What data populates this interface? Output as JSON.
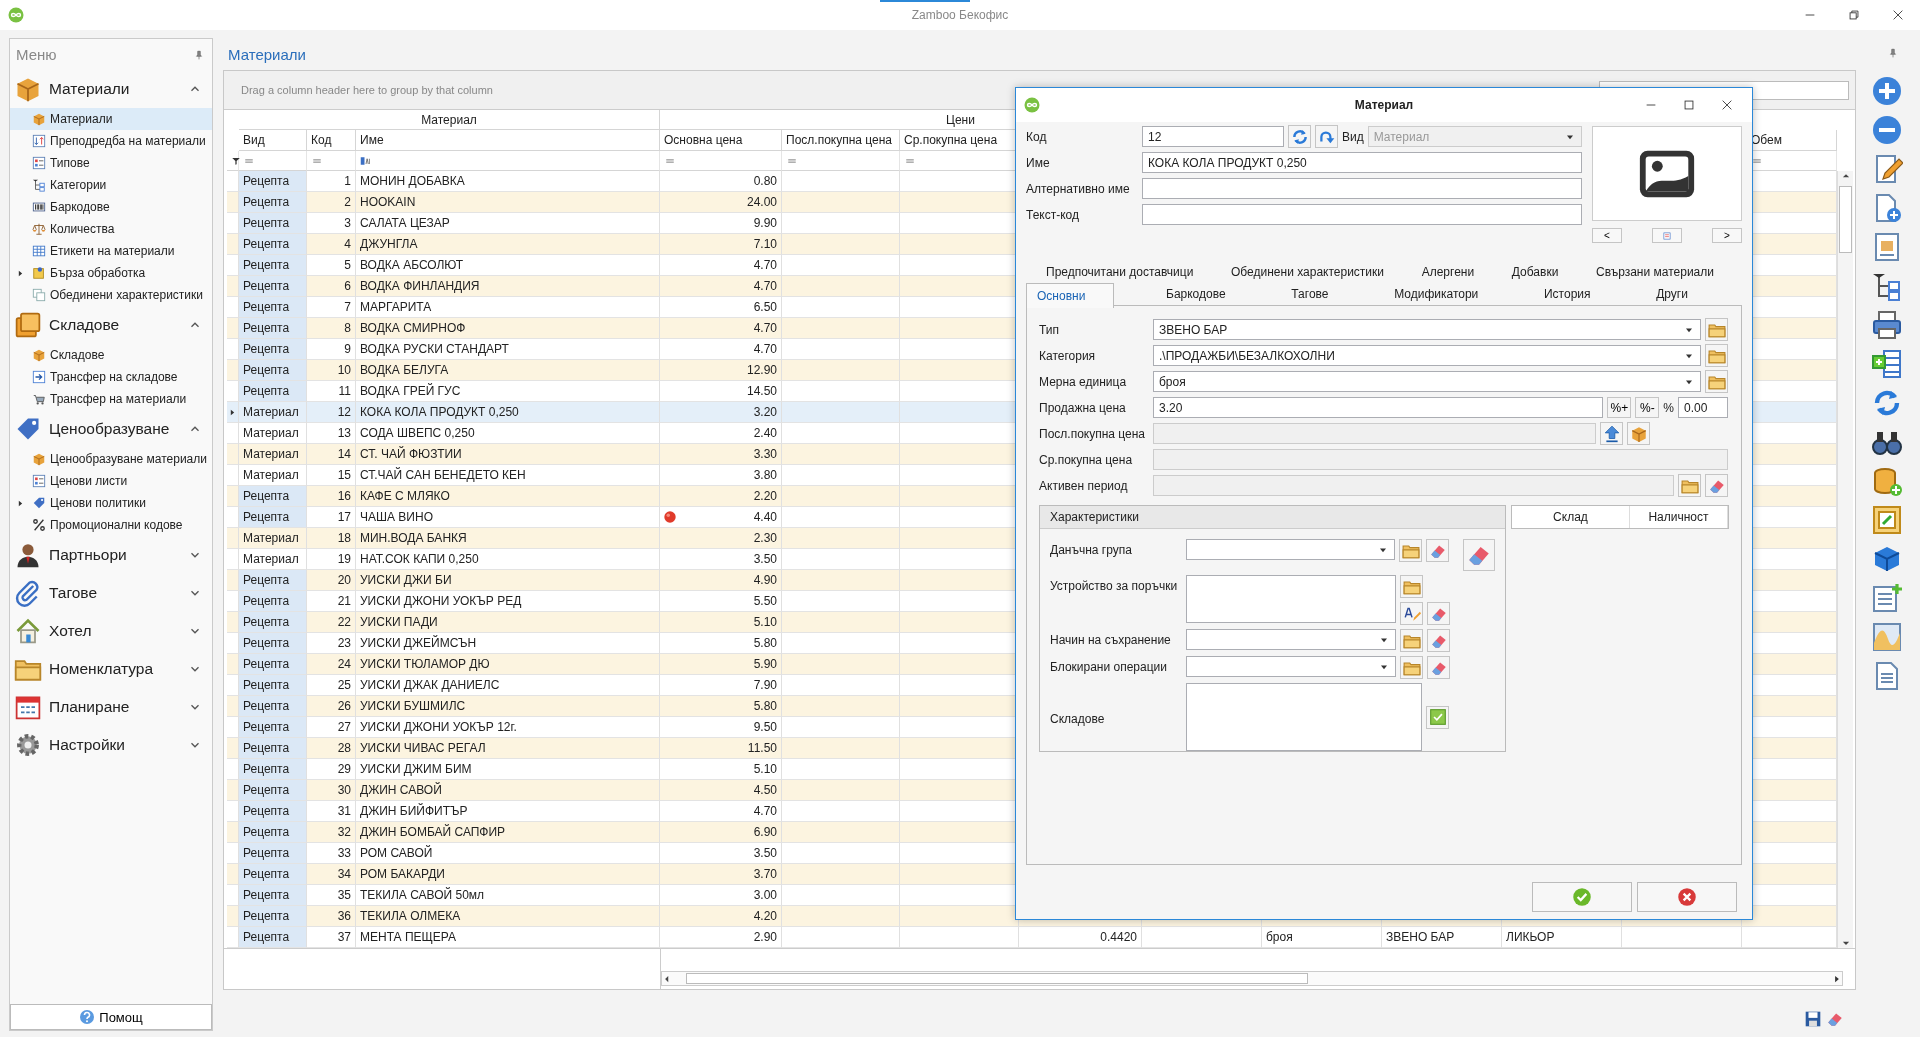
{
  "window": {
    "title": "Zamboo Бекофис"
  },
  "sidebar": {
    "title": "Меню",
    "help_button": "Помощ",
    "groups": [
      {
        "title": "Материали",
        "expanded": true,
        "items": [
          {
            "label": "Материали",
            "selected": true,
            "has_children": false
          },
          {
            "label": "Преподредба на материали",
            "selected": false,
            "has_children": false
          },
          {
            "label": "Типове",
            "selected": false,
            "has_children": false
          },
          {
            "label": "Категории",
            "selected": false,
            "has_children": false
          },
          {
            "label": "Баркодове",
            "selected": false,
            "has_children": false
          },
          {
            "label": "Количества",
            "selected": false,
            "has_children": false
          },
          {
            "label": "Етикети на материали",
            "selected": false,
            "has_children": false
          },
          {
            "label": "Бърза обработка",
            "selected": false,
            "has_children": true
          },
          {
            "label": "Обединени характеристики",
            "selected": false,
            "has_children": false
          }
        ]
      },
      {
        "title": "Складове",
        "expanded": true,
        "items": [
          {
            "label": "Складове",
            "selected": false,
            "has_children": false
          },
          {
            "label": "Трансфер на складове",
            "selected": false,
            "has_children": false
          },
          {
            "label": "Трансфер на материали",
            "selected": false,
            "has_children": false
          }
        ]
      },
      {
        "title": "Ценообразуване",
        "expanded": true,
        "items": [
          {
            "label": "Ценообразуване материали",
            "selected": false,
            "has_children": false
          },
          {
            "label": "Ценови листи",
            "selected": false,
            "has_children": false
          },
          {
            "label": "Ценови политики",
            "selected": false,
            "has_children": true
          },
          {
            "label": "Промоционални кодове",
            "selected": false,
            "has_children": false
          }
        ]
      },
      {
        "title": "Партньори",
        "expanded": false
      },
      {
        "title": "Тагове",
        "expanded": false
      },
      {
        "title": "Хотел",
        "expanded": false
      },
      {
        "title": "Номенклатура",
        "expanded": false
      },
      {
        "title": "Планиране",
        "expanded": false
      },
      {
        "title": "Настройки",
        "expanded": false
      }
    ]
  },
  "page": {
    "title": "Материали"
  },
  "grid": {
    "group_panel_hint": "Drag a column header here to group by that column",
    "bands": [
      {
        "label": "Материал"
      },
      {
        "label": "Цени"
      }
    ],
    "columns": [
      {
        "header": "Вид"
      },
      {
        "header": "Код"
      },
      {
        "header": "Име"
      },
      {
        "header": "Основна цена"
      },
      {
        "header": "Посл.покупна цена"
      },
      {
        "header": "Ср.покупна цена"
      },
      {
        "header": "Обем"
      }
    ],
    "rows": [
      {
        "kind": "recipe",
        "selected": false,
        "flagged": false,
        "type": "Рецепта",
        "code": "1",
        "name": "МОНИН ДОБАВКА",
        "base_price": "0.80"
      },
      {
        "kind": "recipe",
        "selected": false,
        "flagged": false,
        "type": "Рецепта",
        "code": "2",
        "name": "HOOKAIN",
        "base_price": "24.00"
      },
      {
        "kind": "recipe",
        "selected": false,
        "flagged": false,
        "type": "Рецепта",
        "code": "3",
        "name": "САЛАТА ЦЕЗАР",
        "base_price": "9.90"
      },
      {
        "kind": "recipe",
        "selected": false,
        "flagged": false,
        "type": "Рецепта",
        "code": "4",
        "name": "ДЖУНГЛА",
        "base_price": "7.10"
      },
      {
        "kind": "recipe",
        "selected": false,
        "flagged": false,
        "type": "Рецепта",
        "code": "5",
        "name": "ВОДКА АБСОЛЮТ",
        "base_price": "4.70"
      },
      {
        "kind": "recipe",
        "selected": false,
        "flagged": false,
        "type": "Рецепта",
        "code": "6",
        "name": "ВОДКА ФИНЛАНДИЯ",
        "base_price": "4.70"
      },
      {
        "kind": "recipe",
        "selected": false,
        "flagged": false,
        "type": "Рецепта",
        "code": "7",
        "name": "МАРГАРИТА",
        "base_price": "6.50"
      },
      {
        "kind": "recipe",
        "selected": false,
        "flagged": false,
        "type": "Рецепта",
        "code": "8",
        "name": "ВОДКА СМИРНОФ",
        "base_price": "4.70"
      },
      {
        "kind": "recipe",
        "selected": false,
        "flagged": false,
        "type": "Рецепта",
        "code": "9",
        "name": "ВОДКА РУСКИ СТАНДАРТ",
        "base_price": "4.70"
      },
      {
        "kind": "recipe",
        "selected": false,
        "flagged": false,
        "type": "Рецепта",
        "code": "10",
        "name": "ВОДКА БЕЛУГА",
        "base_price": "12.90"
      },
      {
        "kind": "recipe",
        "selected": false,
        "flagged": false,
        "type": "Рецепта",
        "code": "11",
        "name": "ВОДКА ГРЕЙ ГУС",
        "base_price": "14.50"
      },
      {
        "kind": "material",
        "selected": true,
        "flagged": false,
        "type": "Материал",
        "code": "12",
        "name": "КОКА КОЛА ПРОДУКТ 0,250",
        "base_price": "3.20"
      },
      {
        "kind": "material",
        "selected": false,
        "flagged": false,
        "type": "Материал",
        "code": "13",
        "name": "СОДА ШВЕПС 0,250",
        "base_price": "2.40"
      },
      {
        "kind": "material",
        "selected": false,
        "flagged": false,
        "type": "Материал",
        "code": "14",
        "name": "СТ. ЧАЙ ФЮЗТИИ",
        "base_price": "3.30"
      },
      {
        "kind": "material",
        "selected": false,
        "flagged": false,
        "type": "Материал",
        "code": "15",
        "name": "СТ.ЧАЙ САН БЕНЕДЕТО КЕН",
        "base_price": "3.80"
      },
      {
        "kind": "recipe",
        "selected": false,
        "flagged": false,
        "type": "Рецепта",
        "code": "16",
        "name": "КАФЕ С МЛЯКО",
        "base_price": "2.20"
      },
      {
        "kind": "recipe",
        "selected": false,
        "flagged": true,
        "type": "Рецепта",
        "code": "17",
        "name": "ЧАША ВИНО",
        "base_price": "4.40"
      },
      {
        "kind": "material",
        "selected": false,
        "flagged": false,
        "type": "Материал",
        "code": "18",
        "name": "МИН.ВОДА БАНКЯ",
        "base_price": "2.30"
      },
      {
        "kind": "material",
        "selected": false,
        "flagged": false,
        "type": "Материал",
        "code": "19",
        "name": "НАТ.СОК КАПИ 0,250",
        "base_price": "3.50"
      },
      {
        "kind": "recipe",
        "selected": false,
        "flagged": false,
        "type": "Рецепта",
        "code": "20",
        "name": "УИСКИ ДЖИ БИ",
        "base_price": "4.90"
      },
      {
        "kind": "recipe",
        "selected": false,
        "flagged": false,
        "type": "Рецепта",
        "code": "21",
        "name": "УИСКИ ДЖОНИ УОКЪР РЕД",
        "base_price": "5.50"
      },
      {
        "kind": "recipe",
        "selected": false,
        "flagged": false,
        "type": "Рецепта",
        "code": "22",
        "name": "УИСКИ ПАДИ",
        "base_price": "5.10"
      },
      {
        "kind": "recipe",
        "selected": false,
        "flagged": false,
        "type": "Рецепта",
        "code": "23",
        "name": "УИСКИ ДЖЕЙМСЪН",
        "base_price": "5.80"
      },
      {
        "kind": "recipe",
        "selected": false,
        "flagged": false,
        "type": "Рецепта",
        "code": "24",
        "name": "УИСКИ ТЮЛАМОР ДЮ",
        "base_price": "5.90"
      },
      {
        "kind": "recipe",
        "selected": false,
        "flagged": false,
        "type": "Рецепта",
        "code": "25",
        "name": "УИСКИ ДЖАК ДАНИЕЛС",
        "base_price": "7.90"
      },
      {
        "kind": "recipe",
        "selected": false,
        "flagged": false,
        "type": "Рецепта",
        "code": "26",
        "name": "УИСКИ БУШМИЛС",
        "base_price": "5.80"
      },
      {
        "kind": "recipe",
        "selected": false,
        "flagged": false,
        "type": "Рецепта",
        "code": "27",
        "name": "УИСКИ ДЖОНИ УОКЪР 12г.",
        "base_price": "9.50"
      },
      {
        "kind": "recipe",
        "selected": false,
        "flagged": false,
        "type": "Рецепта",
        "code": "28",
        "name": "УИСКИ ЧИВАС РЕГАЛ",
        "base_price": "11.50"
      },
      {
        "kind": "recipe",
        "selected": false,
        "flagged": false,
        "type": "Рецепта",
        "code": "29",
        "name": "УИСКИ ДЖИМ БИМ",
        "base_price": "5.10"
      },
      {
        "kind": "recipe",
        "selected": false,
        "flagged": false,
        "type": "Рецепта",
        "code": "30",
        "name": "ДЖИН САВОЙ",
        "base_price": "4.50"
      },
      {
        "kind": "recipe",
        "selected": false,
        "flagged": false,
        "type": "Рецепта",
        "code": "31",
        "name": "ДЖИН БИЙФИТЪР",
        "base_price": "4.70"
      },
      {
        "kind": "recipe",
        "selected": false,
        "flagged": false,
        "type": "Рецепта",
        "code": "32",
        "name": "ДЖИН БОМБАЙ САПФИР",
        "base_price": "6.90"
      },
      {
        "kind": "recipe",
        "selected": false,
        "flagged": false,
        "type": "Рецепта",
        "code": "33",
        "name": "РОМ САВОЙ",
        "base_price": "3.50"
      },
      {
        "kind": "recipe",
        "selected": false,
        "flagged": false,
        "type": "Рецепта",
        "code": "34",
        "name": "РОМ БАКАРДИ",
        "base_price": "3.70"
      },
      {
        "kind": "recipe",
        "selected": false,
        "flagged": false,
        "type": "Рецепта",
        "code": "35",
        "name": "ТЕКИЛА САВОЙ 50мл",
        "base_price": "3.00"
      },
      {
        "kind": "recipe",
        "selected": false,
        "flagged": false,
        "type": "Рецепта",
        "code": "36",
        "name": "ТЕКИЛА ОЛМЕКА",
        "base_price": "4.20"
      },
      {
        "kind": "recipe",
        "selected": false,
        "flagged": false,
        "type": "Рецепта",
        "code": "37",
        "name": "МЕНТА ПЕЩЕРА",
        "base_price": "2.90",
        "column_7": "0.4420",
        "column_9": "броя",
        "column_10": "ЗВЕНО БАР",
        "column_11": "ЛИКЬОР"
      }
    ]
  },
  "dialog": {
    "title": "Материал",
    "code_field": {
      "label": "Код",
      "value": "12"
    },
    "kind_field": {
      "label": "Вид",
      "value": "Материал",
      "disabled": true
    },
    "name_field": {
      "label": "Име",
      "value": "КОКА КОЛА ПРОДУКТ 0,250"
    },
    "alt_name_field": {
      "label": "Алтернативно име"
    },
    "text_code_field": {
      "label": "Текст-код"
    },
    "image_nav": {
      "previous": "<",
      "next": ">"
    },
    "tab_rows": [
      {
        "tabs": [
          {
            "label": "Предпочитани доставчици",
            "selected": false
          },
          {
            "label": "Обединени характеристики",
            "selected": false
          },
          {
            "label": "Алергени",
            "selected": false
          },
          {
            "label": "Добавки",
            "selected": false
          },
          {
            "label": "Свързани материали",
            "selected": false
          }
        ]
      },
      {
        "tabs": [
          {
            "label": "Основни",
            "selected": true
          },
          {
            "label": "Баркодове",
            "selected": false
          },
          {
            "label": "Тагове",
            "selected": false
          },
          {
            "label": "Модификатори",
            "selected": false
          },
          {
            "label": "История",
            "selected": false
          },
          {
            "label": "Други",
            "selected": false
          }
        ]
      }
    ],
    "fields": [
      {
        "kind": "dropdown",
        "label": "Тип",
        "value": "ЗВЕНО БАР",
        "disabled": false
      },
      {
        "kind": "dropdown",
        "label": "Категория",
        "value": ".\\ПРОДАЖБИ\\БЕЗАЛКОХОЛНИ",
        "disabled": false
      },
      {
        "kind": "dropdown",
        "label": "Мерна единица",
        "value": "броя",
        "disabled": false
      },
      {
        "kind": "price",
        "label": "Продажна цена",
        "value": "3.20",
        "disabled": false,
        "increase_button": "%+",
        "decrease_button": "%-",
        "percent_sign": "%",
        "percent": "0.00"
      },
      {
        "kind": "last_price",
        "label": "Посл.покупна цена",
        "disabled": true
      },
      {
        "kind": "plain",
        "label": "Ср.покупна цена",
        "disabled": true
      },
      {
        "kind": "period",
        "label": "Активен период",
        "disabled": true
      }
    ],
    "characteristics": {
      "title": "Характеристики",
      "fields": [
        {
          "kind": "dropdown",
          "label": "Данъчна група"
        },
        {
          "kind": "memo",
          "label": "Устройство за поръчки"
        },
        {
          "kind": "dropdown",
          "label": "Начин на съхранение"
        },
        {
          "kind": "dropdown",
          "label": "Блокирани операции"
        },
        {
          "kind": "list",
          "label": "Складове"
        }
      ]
    },
    "stock_table": {
      "columns": [
        "Склад",
        "Наличност"
      ]
    }
  }
}
